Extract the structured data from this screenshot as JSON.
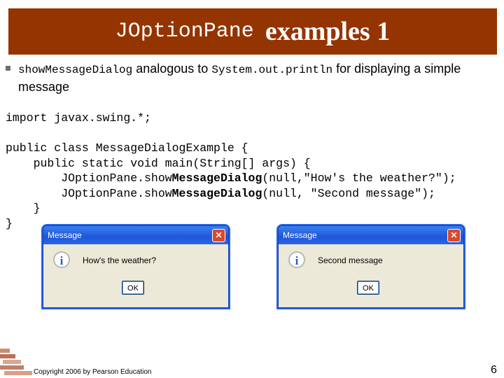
{
  "title": {
    "mono": "JOptionPane",
    "rest": "examples 1"
  },
  "bullet": {
    "mono1": "showMessageDialog",
    "text1": " analogous to ",
    "mono2": "System.out.println",
    "text2": " for displaying a simple message"
  },
  "code": {
    "line1": "import javax.swing.*;",
    "line2": "public class MessageDialogExample {",
    "line3_indent": "    public static void main(String[] args) {",
    "line4_pre": "        JOptionPane.show",
    "line4_bold": "MessageDialog",
    "line4_post": "(null,\"How's the weather?\");",
    "line5_pre": "        JOptionPane.show",
    "line5_bold": "MessageDialog",
    "line5_post": "(null, \"Second message\");",
    "line6": "    }",
    "line7": "}"
  },
  "dialogs": [
    {
      "title": "Message",
      "close": "✕",
      "icon": "i",
      "message": "How's the weather?",
      "ok": "OK"
    },
    {
      "title": "Message",
      "close": "✕",
      "icon": "i",
      "message": "Second message",
      "ok": "OK"
    }
  ],
  "icons": {
    "info": "info-icon",
    "close": "close-icon",
    "bullet": "square-bullet-icon"
  },
  "colors": {
    "title_bg": "#943400",
    "dialog_title": "#1f56d8",
    "dialog_bg": "#ece9d8"
  },
  "footer": {
    "copyright": "Copyright 2006 by Pearson Education",
    "page": "6"
  }
}
